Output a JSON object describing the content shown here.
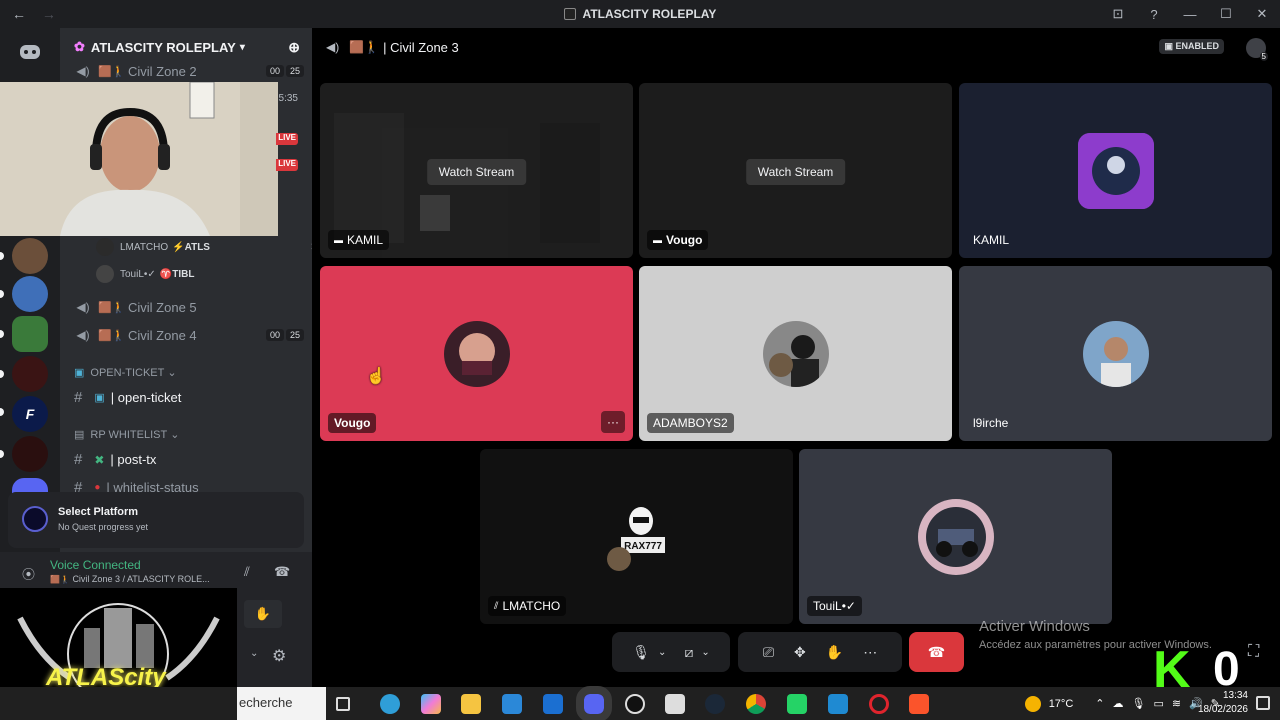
{
  "window": {
    "title": "ATLASCITY ROLEPLAY",
    "nav_back": "←",
    "nav_forward": "→",
    "controls": [
      "⊡",
      "?",
      "—",
      "☐",
      "✕"
    ]
  },
  "server": {
    "name": "ATLASCITY ROLEPLAY"
  },
  "channels": {
    "civil_zone_2": {
      "name": "Civil Zone 2",
      "counts": [
        "00",
        "25"
      ]
    },
    "stream_time": "5:35",
    "live_badges": [
      "LIVE",
      "LIVE"
    ],
    "users": [
      {
        "name": "LMATCHO",
        "tag": "⚡ATLS"
      },
      {
        "name": "TouiL•✓",
        "tag": "♈TIBL"
      }
    ],
    "civil_zone_5": {
      "name": "Civil Zone 5"
    },
    "civil_zone_4": {
      "name": "Civil Zone 4",
      "counts": [
        "00",
        "25"
      ]
    },
    "category_ticket": "OPEN-TICKET",
    "ch_open_ticket": "| open-ticket",
    "category_whitelist": "RP WHITELIST",
    "ch_post_tx": "| post-tx",
    "ch_whitelist_status": "| whitelist-status"
  },
  "quest": {
    "title": "Select Platform",
    "subtitle": "No Quest progress yet"
  },
  "voice": {
    "status": "Voice Connected",
    "channel": "Civil Zone 3 / ATLASCITY ROLE..."
  },
  "main": {
    "channel_title": "| Civil Zone 3",
    "enabled_label": "ENABLED",
    "inbox_count": "5",
    "tiles": [
      {
        "label": "KAMIL",
        "watch": "Watch Stream"
      },
      {
        "label": "Vougo",
        "watch": "Watch Stream"
      },
      {
        "label": "KAMIL"
      },
      {
        "label": "Vougo"
      },
      {
        "label": "ADAMBOYS2"
      },
      {
        "label": "l9irche"
      },
      {
        "label": "LMATCHO"
      },
      {
        "label": "TouiL•✓"
      }
    ],
    "more_dots": "···"
  },
  "logo_text": "ATLAScity",
  "activate_windows": {
    "title": "Activer Windows",
    "subtitle": "Accédez aux paramètres pour activer Windows."
  },
  "taskbar": {
    "search": "echerche",
    "weather": "17°C",
    "time": "13:34",
    "date": "18/02/2026"
  },
  "overlay": {
    "letter": "K",
    "number": "0"
  }
}
